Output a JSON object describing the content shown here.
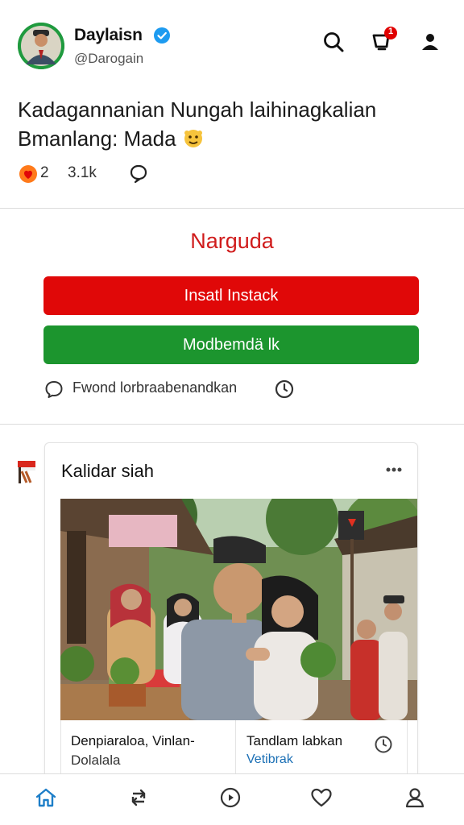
{
  "post": {
    "display_name": "Daylaisn",
    "handle": "@Darogain",
    "text_line1": "Kadagannanian Nungah laihinagkalian",
    "text_line2": "Bmanlang: Mada",
    "reaction_count": "2",
    "views": "3.1k",
    "notification_count": "1"
  },
  "install_card": {
    "title": "Narguda",
    "primary_button": "Insatl Instack",
    "secondary_button": "Modbemdä lk",
    "friend_text": "Fwond lorbraabenandkan"
  },
  "feed_card": {
    "title": "Kalidar siah",
    "caption_location": "Denpiaraloa, Vinlan-",
    "caption_sub": "Dolalala",
    "caption_title": "Tandlam labkan",
    "caption_link": "Vetibrak"
  },
  "colors": {
    "accent_red": "#e00808",
    "accent_green": "#1c952e",
    "title_red": "#d01c1c",
    "link_blue": "#1a6fb5",
    "verified_blue": "#1d9bf0"
  },
  "icons": {
    "header": [
      "search-icon",
      "notification-icon",
      "profile-icon"
    ],
    "nav": [
      "home-icon",
      "repost-icon",
      "explore-icon",
      "heart-icon",
      "profile-icon"
    ]
  }
}
